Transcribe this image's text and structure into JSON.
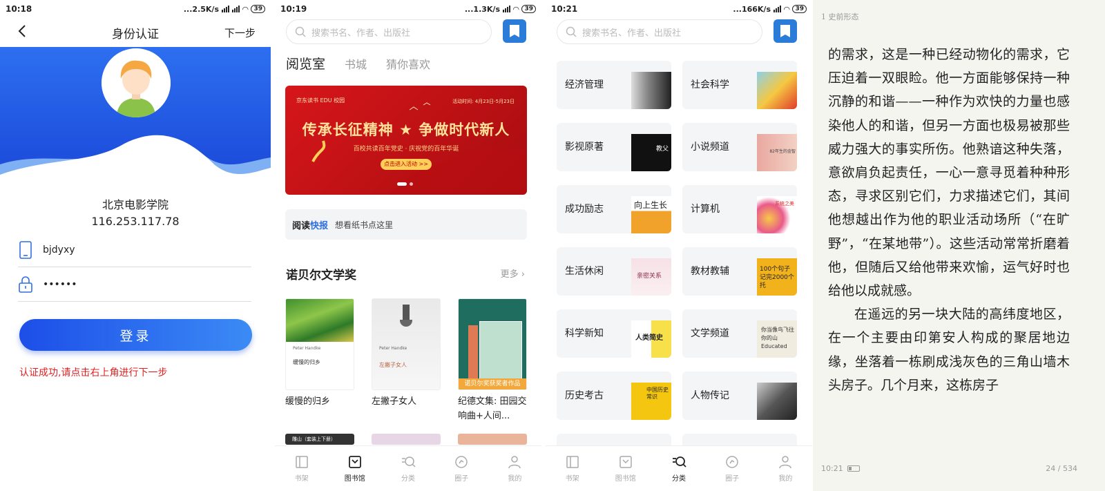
{
  "panel1": {
    "status": {
      "time": "10:18",
      "speed": "...2.5K/s",
      "battery": "39"
    },
    "title": "身份认证",
    "next_label": "下一步",
    "school": "北京电影学院",
    "ip": "116.253.117.78",
    "username": "bjdyxy",
    "password": "••••••",
    "login_label": "登录",
    "message": "认证成功,请点击右上角进行下一步"
  },
  "panel2": {
    "status": {
      "time": "10:19",
      "speed": "...1.3K/s",
      "battery": "39"
    },
    "search_placeholder": "搜索书名、作者、出版社",
    "tabs": [
      "阅览室",
      "书城",
      "猜你喜欢"
    ],
    "banner": {
      "brand": "京东读书 EDU 校园",
      "date": "活动时间: 4月23日-5月23日",
      "title": "传承长征精神 ★ 争做时代新人",
      "subtitle": "百校共读百年党史 · 庆祝党的百年华诞",
      "button": "点击进入活动 >>"
    },
    "quick": {
      "part1": "阅读",
      "part2": "快报",
      "text": "想看纸书点这里"
    },
    "section_title": "诺贝尔文学奖",
    "more_label": "更多 ›",
    "books": [
      {
        "title": "缓慢的归乡",
        "cover_text": "缓慢的归乡",
        "author": "Peter Handke"
      },
      {
        "title": "左撇子女人",
        "cover_text": "左撇子女人",
        "author": "Peter Handke"
      },
      {
        "title": "纪德文集: 田园交响曲+人间...",
        "cover_text": "诺贝尔奖获奖者作品",
        "author": ""
      }
    ],
    "peek_label": "雕山（套装上下册）",
    "nav": [
      "书架",
      "图书馆",
      "分类",
      "圈子",
      "我的"
    ],
    "nav_active": 1
  },
  "panel3": {
    "status": {
      "time": "10:21",
      "speed": "...166K/s",
      "battery": "39"
    },
    "search_placeholder": "搜索书名、作者、出版社",
    "categories": [
      {
        "label": "经济管理",
        "thumb": "portrait"
      },
      {
        "label": "社会科学",
        "thumb": "cartoon"
      },
      {
        "label": "影视原著",
        "thumb": "tuxedo",
        "thumb_text": "教父"
      },
      {
        "label": "小说频道",
        "thumb": "face",
        "thumb_text": "82年生的金智"
      },
      {
        "label": "成功励志",
        "thumb": "orange",
        "thumb_text": "向上生长"
      },
      {
        "label": "计算机",
        "thumb": "spiral",
        "thumb_text": "系统之美"
      },
      {
        "label": "生活休闲",
        "thumb": "pink",
        "thumb_text": "亲密关系"
      },
      {
        "label": "教材教辅",
        "thumb": "yellow",
        "thumb_text": "100个句子记完2000个托"
      },
      {
        "label": "科学新知",
        "thumb": "sapiens",
        "thumb_text": "人类简史"
      },
      {
        "label": "文学频道",
        "thumb": "educated",
        "thumb_text": "你当像鸟飞往你的山 Educated"
      },
      {
        "label": "历史考古",
        "thumb": "history",
        "thumb_text": "中国历史常识"
      },
      {
        "label": "人物传记",
        "thumb": "bw"
      }
    ],
    "nav": [
      "书架",
      "图书馆",
      "分类",
      "圈子",
      "我的"
    ],
    "nav_active": 2
  },
  "panel4": {
    "chapter": "1 史前形态",
    "paragraphs": [
      {
        "indent": false,
        "text": "的需求，这是一种已经动物化的需求，它压迫着一双眼睑。他一方面能够保持一种沉静的和谐——一种作为欢快的力量也感染他人的和谐，但另一方面也极易被那些威力强大的事实所伤。他熟谙这种失落，意欲肩负起责任，一心一意寻觅着种种形态，寻求区别它们，力求描述它们，其间他想越出作为他的职业活动场所（“在旷野”，“在某地带”）。这些活动常常折磨着他，但随后又给他带来欢愉，运气好时也给他以成就感。"
      },
      {
        "indent": true,
        "text": "在遥远的另一块大陆的高纬度地区，在一个主要由印第安人构成的聚居地边缘，坐落着一栋刷成浅灰色的三角山墙木头房子。几个月来，这栋房子"
      }
    ],
    "time": "10:21",
    "page": "24 / 534"
  },
  "colors": {
    "accent": "#2f6fe0",
    "error": "#e02020",
    "banner_red": "#d6161a"
  }
}
